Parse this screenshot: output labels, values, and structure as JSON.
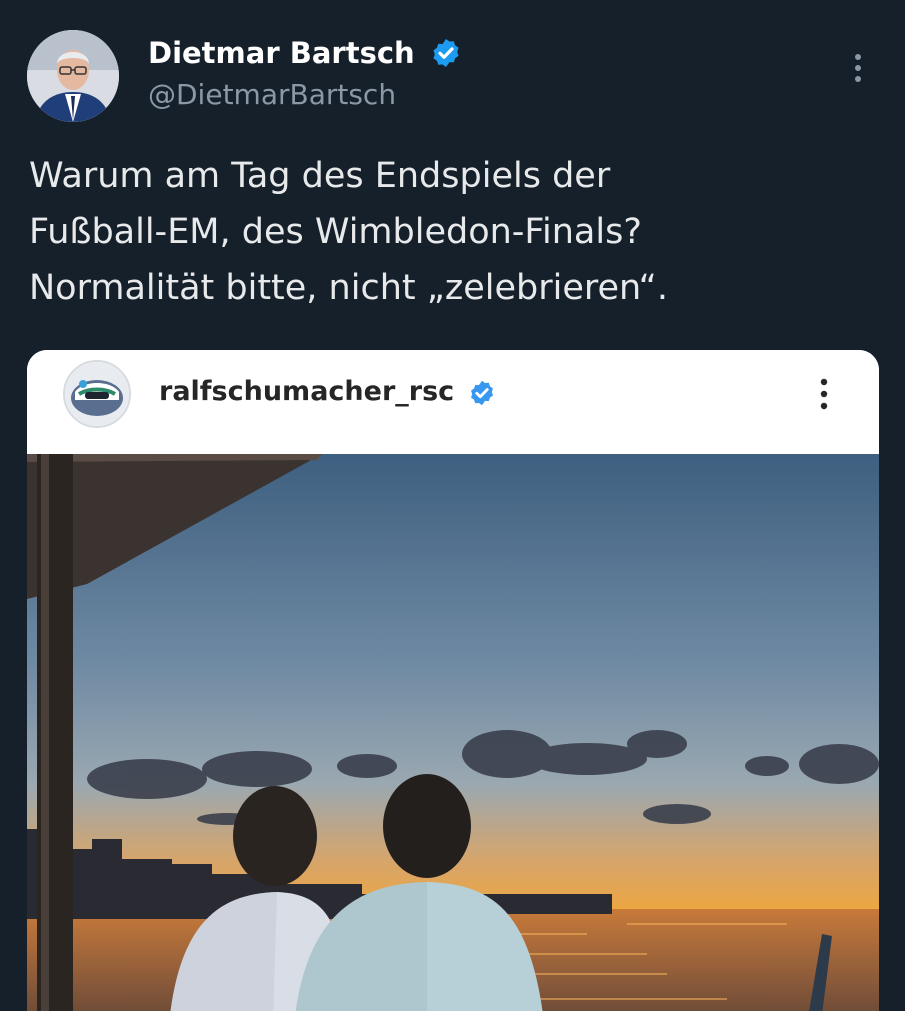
{
  "tweet": {
    "author_name": "Dietmar Bartsch",
    "author_handle": "@DietmarBartsch",
    "text_lines": [
      "Warum am Tag des Endspiels der",
      "Fußball-EM, des Wimbledon-Finals?",
      "Normalität bitte, nicht „zelebrieren“."
    ]
  },
  "embedded_post": {
    "username": "ralfschumacher_rsc"
  },
  "icons": {
    "verified": "verified-badge-icon",
    "more": "more-options-icon"
  },
  "colors": {
    "background": "#15202b",
    "verified_blue": "#1d9bf0",
    "instagram_verified": "#3897f0",
    "handle_gray": "#8b98a5"
  }
}
